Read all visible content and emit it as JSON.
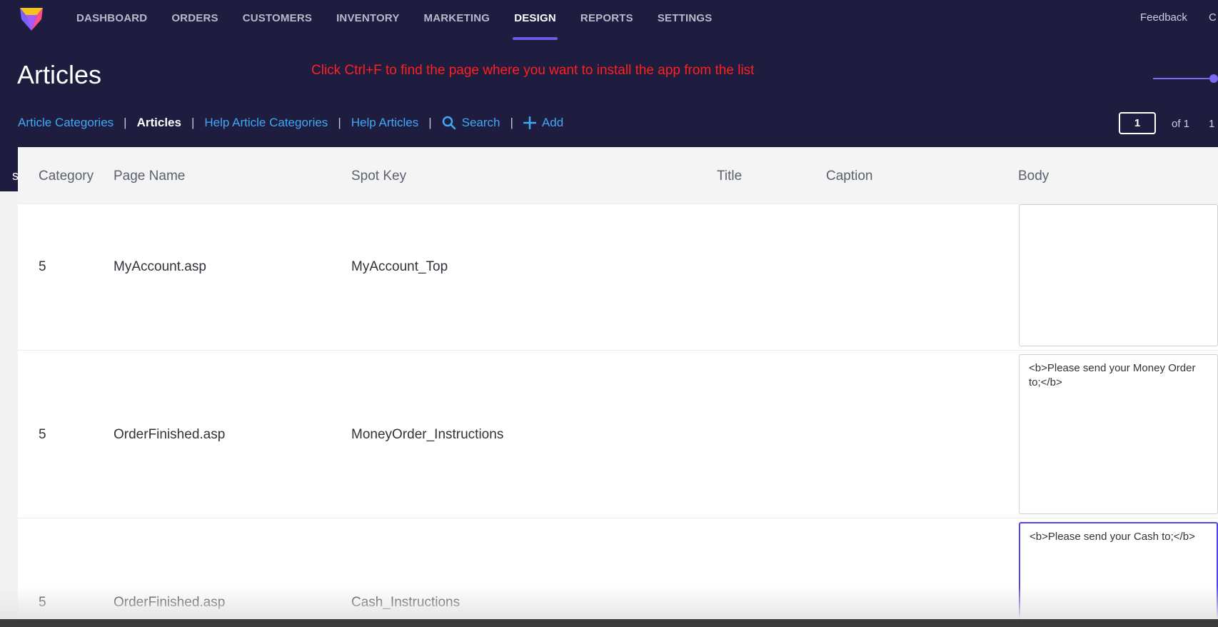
{
  "nav": {
    "items": [
      {
        "label": "DASHBOARD"
      },
      {
        "label": "ORDERS"
      },
      {
        "label": "CUSTOMERS"
      },
      {
        "label": "INVENTORY"
      },
      {
        "label": "MARKETING"
      },
      {
        "label": "DESIGN",
        "active": true
      },
      {
        "label": "REPORTS"
      },
      {
        "label": "SETTINGS"
      }
    ],
    "feedback": "Feedback",
    "feedback_extra": "C"
  },
  "page": {
    "title": "Articles",
    "notice": "Click Ctrl+F to find the page where you want to install the app from the list"
  },
  "subnav": {
    "article_categories": "Article Categories",
    "articles": "Articles",
    "help_article_categories": "Help Article Categories",
    "help_articles": "Help Articles",
    "search": "Search",
    "add": "Add",
    "separator": "|"
  },
  "pager": {
    "current": "1",
    "of": "of 1",
    "extra": "1"
  },
  "table": {
    "cut_column": "s",
    "headers": {
      "category": "Category",
      "page_name": "Page Name",
      "spot_key": "Spot Key",
      "title": "Title",
      "caption": "Caption",
      "body": "Body"
    },
    "rows": [
      {
        "category": "5",
        "page_name": "MyAccount.asp",
        "spot_key": "MyAccount_Top",
        "title": "",
        "caption": "",
        "body": ""
      },
      {
        "category": "5",
        "page_name": "OrderFinished.asp",
        "spot_key": "MoneyOrder_Instructions",
        "title": "",
        "caption": "",
        "body": "<b>Please send your Money Order to;</b>"
      },
      {
        "category": "5",
        "page_name": "OrderFinished.asp",
        "spot_key": "Cash_Instructions",
        "title": "",
        "caption": "",
        "body": "<b>Please send your Cash to;</b>"
      }
    ]
  },
  "colors": {
    "header_bg": "#1e1c3f",
    "accent": "#6b5ce7",
    "link": "#3fa9f5",
    "notice": "#ff2020"
  }
}
